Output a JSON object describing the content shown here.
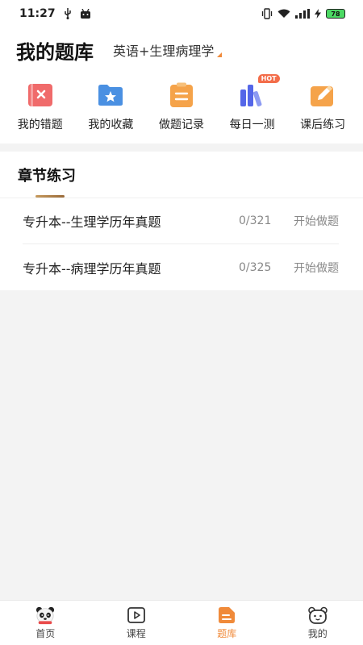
{
  "status_bar": {
    "time": "11:27",
    "battery": "78"
  },
  "header": {
    "title": "我的题库",
    "subject": "英语+生理病理学"
  },
  "shortcuts": [
    {
      "label": "我的错题",
      "icon": "wrong-book-icon",
      "color": "#f06b6b"
    },
    {
      "label": "我的收藏",
      "icon": "star-folder-icon",
      "color": "#4a90e2"
    },
    {
      "label": "做题记录",
      "icon": "clipboard-icon",
      "color": "#f5a34a"
    },
    {
      "label": "每日一测",
      "icon": "books-icon",
      "color": "#5466e8",
      "badge": "HOT"
    },
    {
      "label": "课后练习",
      "icon": "pencil-note-icon",
      "color": "#f5a34a"
    }
  ],
  "chapter_section": {
    "title": "章节练习",
    "items": [
      {
        "name": "专升本--生理学历年真题",
        "progress": "0/321",
        "action": "开始做题"
      },
      {
        "name": "专升本--病理学历年真题",
        "progress": "0/325",
        "action": "开始做题"
      }
    ]
  },
  "bottom_nav": {
    "items": [
      {
        "label": "首页"
      },
      {
        "label": "课程"
      },
      {
        "label": "题库"
      },
      {
        "label": "我的"
      }
    ],
    "active_color": "#f08a3a"
  }
}
